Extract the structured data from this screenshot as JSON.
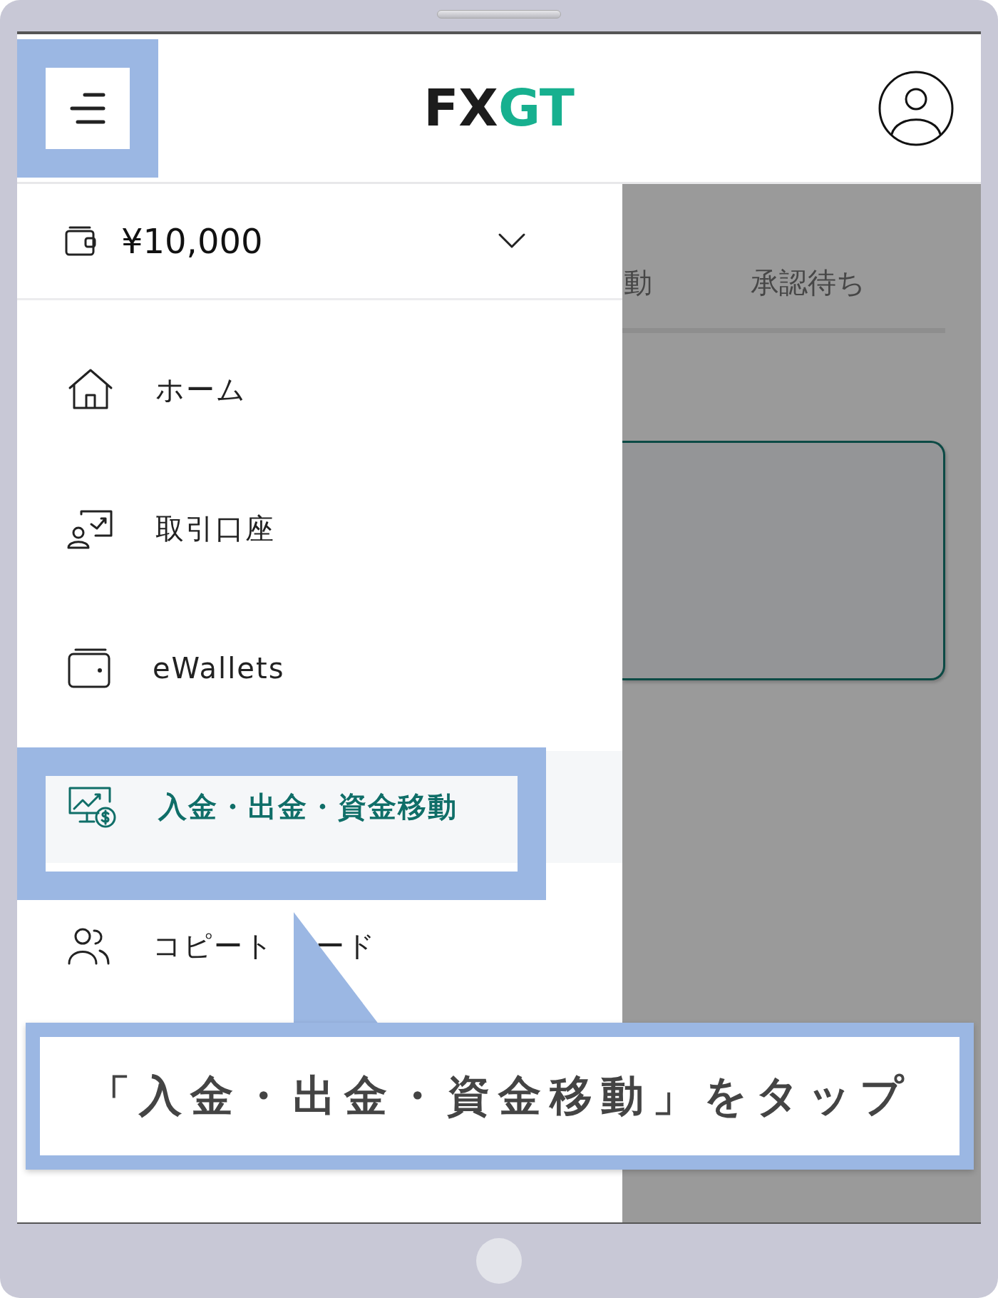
{
  "header": {
    "logo": [
      "FX",
      "GT"
    ]
  },
  "balance": {
    "amount": "¥10,000",
    "expanded": false
  },
  "menu": [
    {
      "label_parts": [
        "ホーム"
      ],
      "selected": false
    },
    {
      "label_parts": [
        "取引口座"
      ],
      "selected": false
    },
    {
      "label_parts": [
        "eWallets"
      ],
      "selected": false
    },
    {
      "label_parts": [
        "入金・出金・資金移動"
      ],
      "selected": true
    },
    {
      "label_parts": [
        "コピート",
        "ード"
      ],
      "selected": false
    }
  ],
  "background_tabs": [
    "動",
    "承認待ち"
  ],
  "callout": {
    "text": "「入金・出金・資金移動」をタップ"
  }
}
